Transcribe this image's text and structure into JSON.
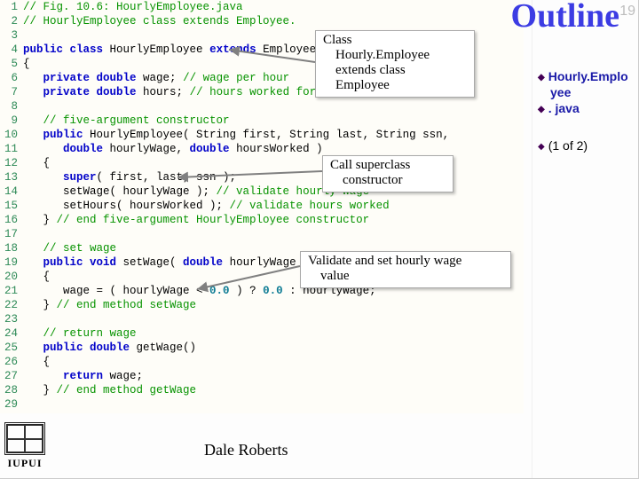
{
  "outline": {
    "title": "Outline",
    "slide_number": "19",
    "items": [
      {
        "label": "Hourly.Emplo"
      },
      {
        "label": "yee"
      },
      {
        "label": ". java"
      }
    ],
    "progress": "(1 of 2)"
  },
  "callouts": {
    "c1": {
      "l1": "Class",
      "l2": "Hourly.Employee",
      "l3": "extends class",
      "l4": "Employee"
    },
    "c2": {
      "l1": "Call superclass",
      "l2": "constructor"
    },
    "c3": {
      "l1": "Validate and set hourly wage",
      "l2": "value"
    }
  },
  "code": {
    "lines": [
      {
        "n": "1",
        "segs": [
          [
            "cmt",
            "// Fig. 10.6: HourlyEmployee.java"
          ]
        ]
      },
      {
        "n": "2",
        "segs": [
          [
            "cmt",
            "// HourlyEmployee class extends Employee."
          ]
        ]
      },
      {
        "n": "3",
        "segs": []
      },
      {
        "n": "4",
        "segs": [
          [
            "kw",
            "public class "
          ],
          [
            "id",
            "HourlyEmployee "
          ],
          [
            "kw",
            "extends "
          ],
          [
            "id",
            "Employee"
          ]
        ]
      },
      {
        "n": "5",
        "segs": [
          [
            "punc",
            "{"
          ]
        ]
      },
      {
        "n": "6",
        "segs": [
          [
            "id",
            "   "
          ],
          [
            "kw",
            "private double "
          ],
          [
            "id",
            "wage; "
          ],
          [
            "cmt",
            "// wage per hour"
          ]
        ]
      },
      {
        "n": "7",
        "segs": [
          [
            "id",
            "   "
          ],
          [
            "kw",
            "private double "
          ],
          [
            "id",
            "hours; "
          ],
          [
            "cmt",
            "// hours worked for week"
          ]
        ]
      },
      {
        "n": "8",
        "segs": []
      },
      {
        "n": "9",
        "segs": [
          [
            "id",
            "   "
          ],
          [
            "cmt",
            "// five-argument constructor"
          ]
        ]
      },
      {
        "n": "10",
        "segs": [
          [
            "id",
            "   "
          ],
          [
            "kw",
            "public "
          ],
          [
            "id",
            "HourlyEmployee( String first, String last, String ssn,"
          ]
        ]
      },
      {
        "n": "11",
        "segs": [
          [
            "id",
            "      "
          ],
          [
            "kw",
            "double "
          ],
          [
            "id",
            "hourlyWage, "
          ],
          [
            "kw",
            "double "
          ],
          [
            "id",
            "hoursWorked )"
          ]
        ]
      },
      {
        "n": "12",
        "segs": [
          [
            "id",
            "   {"
          ]
        ]
      },
      {
        "n": "13",
        "segs": [
          [
            "id",
            "      "
          ],
          [
            "kw",
            "super"
          ],
          [
            "id",
            "( first, last, ssn );"
          ]
        ]
      },
      {
        "n": "14",
        "segs": [
          [
            "id",
            "      setWage( hourlyWage ); "
          ],
          [
            "cmt",
            "// validate hourly wage"
          ]
        ]
      },
      {
        "n": "15",
        "segs": [
          [
            "id",
            "      setHours( hoursWorked ); "
          ],
          [
            "cmt",
            "// validate hours worked"
          ]
        ]
      },
      {
        "n": "16",
        "segs": [
          [
            "id",
            "   } "
          ],
          [
            "cmt",
            "// end five-argument HourlyEmployee constructor"
          ]
        ]
      },
      {
        "n": "17",
        "segs": []
      },
      {
        "n": "18",
        "segs": [
          [
            "id",
            "   "
          ],
          [
            "cmt",
            "// set wage"
          ]
        ]
      },
      {
        "n": "19",
        "segs": [
          [
            "id",
            "   "
          ],
          [
            "kw",
            "public void "
          ],
          [
            "id",
            "setWage( "
          ],
          [
            "kw",
            "double "
          ],
          [
            "id",
            "hourlyWage )"
          ]
        ]
      },
      {
        "n": "20",
        "segs": [
          [
            "id",
            "   {"
          ]
        ]
      },
      {
        "n": "21",
        "segs": [
          [
            "id",
            "      wage = ( hourlyWage < "
          ],
          [
            "lit",
            "0.0"
          ],
          [
            "id",
            " ) ? "
          ],
          [
            "lit",
            "0.0"
          ],
          [
            "id",
            " : hourlyWage;"
          ]
        ]
      },
      {
        "n": "22",
        "segs": [
          [
            "id",
            "   } "
          ],
          [
            "cmt",
            "// end method setWage"
          ]
        ]
      },
      {
        "n": "23",
        "segs": []
      },
      {
        "n": "24",
        "segs": [
          [
            "id",
            "   "
          ],
          [
            "cmt",
            "// return wage"
          ]
        ]
      },
      {
        "n": "25",
        "segs": [
          [
            "id",
            "   "
          ],
          [
            "kw",
            "public double "
          ],
          [
            "id",
            "getWage()"
          ]
        ]
      },
      {
        "n": "26",
        "segs": [
          [
            "id",
            "   {"
          ]
        ]
      },
      {
        "n": "27",
        "segs": [
          [
            "id",
            "      "
          ],
          [
            "kw",
            "return "
          ],
          [
            "id",
            "wage;"
          ]
        ]
      },
      {
        "n": "28",
        "segs": [
          [
            "id",
            "   } "
          ],
          [
            "cmt",
            "// end method getWage"
          ]
        ]
      },
      {
        "n": "29",
        "segs": []
      }
    ]
  },
  "footer": {
    "name": "Dale Roberts",
    "logo_word": "IUPUI"
  }
}
